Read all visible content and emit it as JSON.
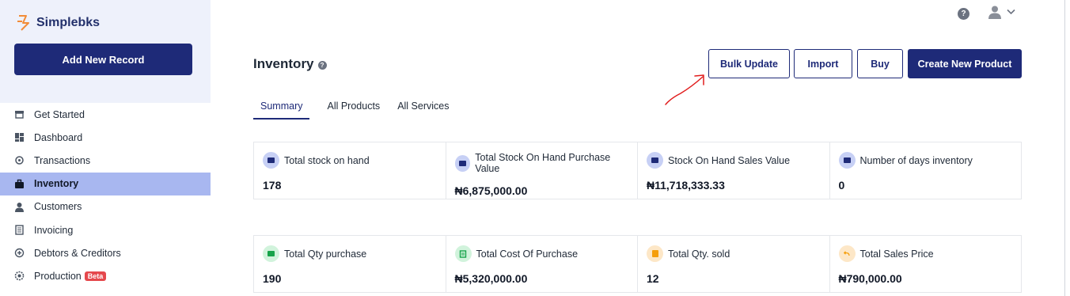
{
  "app": {
    "name": "Simplebks",
    "add_record_label": "Add New Record"
  },
  "sidebar": {
    "items": [
      {
        "label": "Get Started",
        "icon": "store-icon"
      },
      {
        "label": "Dashboard",
        "icon": "dashboard-icon"
      },
      {
        "label": "Transactions",
        "icon": "exchange-icon"
      },
      {
        "label": "Inventory",
        "icon": "briefcase-icon",
        "active": true
      },
      {
        "label": "Customers",
        "icon": "user-icon"
      },
      {
        "label": "Invoicing",
        "icon": "invoice-icon"
      },
      {
        "label": "Debtors & Creditors",
        "icon": "scale-icon"
      },
      {
        "label": "Production",
        "icon": "factory-icon",
        "badge": "Beta"
      }
    ]
  },
  "header": {
    "title": "Inventory",
    "help_glyph": "?",
    "buttons": {
      "bulk_update": "Bulk Update",
      "import": "Import",
      "buy": "Buy",
      "create": "Create New Product"
    }
  },
  "tabs": [
    {
      "label": "Summary",
      "active": true
    },
    {
      "label": "All Products"
    },
    {
      "label": "All Services"
    }
  ],
  "cards_row1": [
    {
      "label": "Total stock on hand",
      "value": "178",
      "icon_color": "#1e2a78",
      "icon_bg": "#c7d0f5"
    },
    {
      "label": "Total Stock On Hand Purchase Value",
      "value": "₦6,875,000.00",
      "icon_color": "#1e2a78",
      "icon_bg": "#c7d0f5"
    },
    {
      "label": "Stock On Hand Sales Value",
      "value": "₦11,718,333.33",
      "icon_color": "#1e2a78",
      "icon_bg": "#c7d0f5"
    },
    {
      "label": "Number of days inventory",
      "value": "0",
      "icon_color": "#1e2a78",
      "icon_bg": "#c7d0f5"
    }
  ],
  "cards_row2": [
    {
      "label": "Total Qty purchase",
      "value": "190",
      "icon_color": "#16a34a",
      "icon_bg": "#d1f3dc"
    },
    {
      "label": "Total Cost Of Purchase",
      "value": "₦5,320,000.00",
      "icon_color": "#16a34a",
      "icon_bg": "#d1f3dc"
    },
    {
      "label": "Total Qty. sold",
      "value": "12",
      "icon_color": "#f59e0b",
      "icon_bg": "#fde7c7"
    },
    {
      "label": "Total Sales Price",
      "value": "₦790,000.00",
      "icon_color": "#f59e0b",
      "icon_bg": "#fde7c7"
    }
  ],
  "colors": {
    "brand": "#1e2a78",
    "sidebar_active": "#a8b7f0",
    "annotation_arrow": "#e11d1d"
  }
}
